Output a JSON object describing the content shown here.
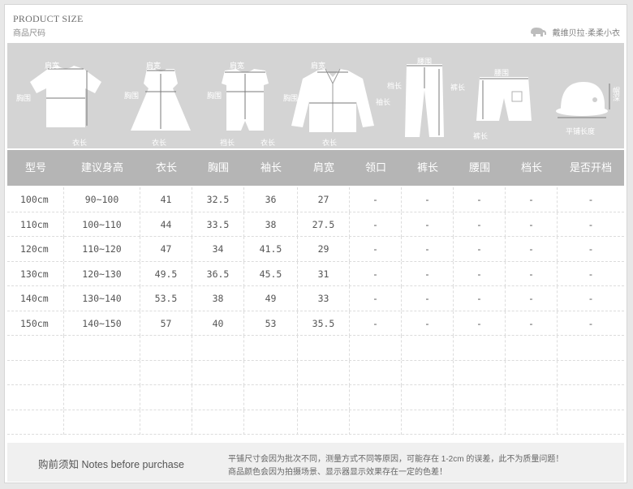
{
  "header": {
    "title_en": "PRODUCT SIZE",
    "title_cn": "商品尺码",
    "brand": "戴维贝拉·柔柔小衣"
  },
  "illustrations": {
    "tshirt": {
      "shoulder": "肩宽",
      "chest": "胸围",
      "length": "衣长"
    },
    "dress": {
      "shoulder": "肩宽",
      "chest": "胸围",
      "length": "衣长"
    },
    "romper": {
      "shoulder": "肩宽",
      "chest": "胸围",
      "crotch": "裆长",
      "length": "衣长"
    },
    "jacket": {
      "shoulder": "肩宽",
      "chest": "胸围",
      "sleeve": "袖长",
      "length": "衣长"
    },
    "pants": {
      "waist": "腰围",
      "crotch": "档长",
      "pants_length": "裤长"
    },
    "shorts": {
      "waist": "腰围",
      "pants_length": "裤长"
    },
    "hat": {
      "brim": "帽深",
      "flat": "平铺长度"
    }
  },
  "table": {
    "headers": [
      "型号",
      "建议身高",
      "衣长",
      "胸围",
      "袖长",
      "肩宽",
      "领口",
      "裤长",
      "腰围",
      "档长",
      "是否开档"
    ],
    "rows": [
      [
        "100cm",
        "90~100",
        "41",
        "32.5",
        "36",
        "27",
        "-",
        "-",
        "-",
        "-",
        "-"
      ],
      [
        "110cm",
        "100~110",
        "44",
        "33.5",
        "38",
        "27.5",
        "-",
        "-",
        "-",
        "-",
        "-"
      ],
      [
        "120cm",
        "110~120",
        "47",
        "34",
        "41.5",
        "29",
        "-",
        "-",
        "-",
        "-",
        "-"
      ],
      [
        "130cm",
        "120~130",
        "49.5",
        "36.5",
        "45.5",
        "31",
        "-",
        "-",
        "-",
        "-",
        "-"
      ],
      [
        "140cm",
        "130~140",
        "53.5",
        "38",
        "49",
        "33",
        "-",
        "-",
        "-",
        "-",
        "-"
      ],
      [
        "150cm",
        "140~150",
        "57",
        "40",
        "53",
        "35.5",
        "-",
        "-",
        "-",
        "-",
        "-"
      ],
      [
        "",
        "",
        "",
        "",
        "",
        "",
        "",
        "",
        "",
        "",
        ""
      ],
      [
        "",
        "",
        "",
        "",
        "",
        "",
        "",
        "",
        "",
        "",
        ""
      ],
      [
        "",
        "",
        "",
        "",
        "",
        "",
        "",
        "",
        "",
        "",
        ""
      ],
      [
        "",
        "",
        "",
        "",
        "",
        "",
        "",
        "",
        "",
        "",
        ""
      ]
    ]
  },
  "notes": {
    "title": "购前须知 Notes before purchase",
    "line1": "平铺尺寸会因为批次不同，测量方式不同等原因，可能存在 1-2cm 的误差，此不为质量问题！",
    "line2": "商品颜色会因为拍摄场景、显示器显示效果存在一定的色差！"
  },
  "colors": {
    "page_bg": "#e8e8e8",
    "band_bg": "#d4d4d4",
    "header_row_bg": "#b5b5b5",
    "text": "#555555"
  }
}
